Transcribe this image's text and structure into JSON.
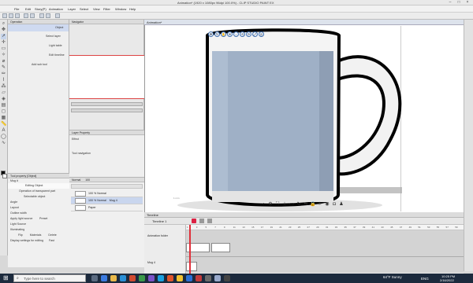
{
  "window": {
    "title": "Animation* (1920 x 1080px 96dpi 100.0%) - CLIP STUDIO PAINT EX"
  },
  "menu": [
    "File",
    "Edit",
    "Story(P)",
    "Animation",
    "Layer",
    "Select",
    "View",
    "Filter",
    "Window",
    "Help"
  ],
  "subtool_panel": {
    "tab": "Operation",
    "items": [
      "Object",
      "Select layer",
      "Light table",
      "Edit timeline"
    ],
    "add_label": "Add sub tool"
  },
  "navigator": {
    "tab": "Navigator"
  },
  "layer_property": {
    "tab": "Layer Property",
    "effect": "Effect",
    "tool_nav": "Tool navigation"
  },
  "tool_property": {
    "tab": "Tool property [Object]",
    "title": "Mug #",
    "rows": [
      "Editing Object",
      "Operation of transparent part",
      "Selectable object",
      "Angle",
      "Layout",
      "Outline width",
      "Apply light source",
      "Light Source",
      "Illuminating",
      "Display settings for editing"
    ],
    "angle_value": "Preset",
    "illum_opts": [
      "Flip",
      "Materials",
      "Delete"
    ],
    "display_value": "Fast"
  },
  "layers": {
    "blend": "Normal",
    "opacity": "100",
    "rows": [
      {
        "name": "100 % Normal",
        "sub": "3D Camera"
      },
      {
        "name": "100 % Normal",
        "sub": "Mug 4"
      },
      {
        "name": "Paper",
        "sub": ""
      }
    ]
  },
  "canvas": {
    "tab": "Animation*",
    "corner_note": "1 mm",
    "mug_body_color": "#9fb0c6",
    "mug_white": "#f4f4f4"
  },
  "timeline": {
    "tab": "Timeline",
    "name": "Timeline 1",
    "tracks": [
      "Animation folder",
      "Mug 4"
    ],
    "ticks": [
      "1",
      "2",
      "3",
      "4",
      "5",
      "6",
      "7",
      "8",
      "9",
      "10",
      "11",
      "12",
      "13",
      "14",
      "15",
      "16",
      "17",
      "18",
      "19",
      "20",
      "21",
      "22",
      "23",
      "24",
      "25",
      "26",
      "27",
      "28",
      "29",
      "30",
      "31",
      "32",
      "33",
      "34",
      "35",
      "36",
      "37",
      "38",
      "39",
      "40",
      "41",
      "42",
      "43",
      "44",
      "45",
      "46",
      "47",
      "48",
      "49",
      "50",
      "51",
      "52",
      "53",
      "54",
      "55",
      "56",
      "57",
      "58",
      "59",
      "60"
    ]
  },
  "taskbar": {
    "search_placeholder": "Type here to search",
    "weather": "64°F  Sunny",
    "lang": "ENG",
    "time": "10:25 PM",
    "date": "2/16/2022"
  }
}
